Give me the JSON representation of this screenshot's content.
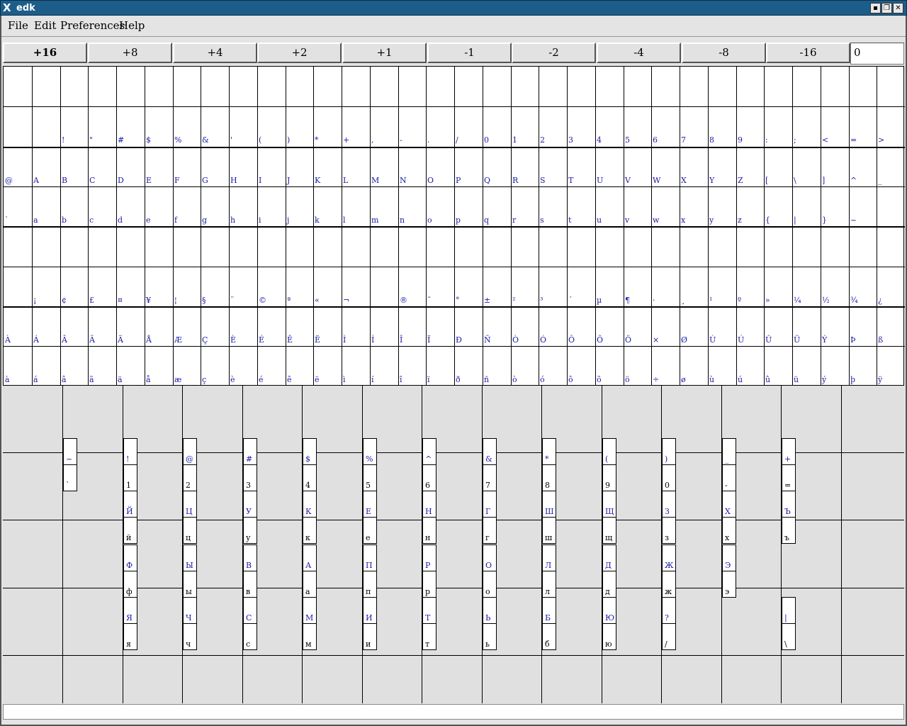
{
  "window": {
    "title": "edk",
    "icon": "x-logo-icon",
    "buttons": [
      "minimize-icon",
      "restore-icon",
      "close-icon"
    ]
  },
  "menu": [
    "File",
    "Edit",
    "Preferences",
    "Help"
  ],
  "steps": [
    "+16",
    "+8",
    "+4",
    "+2",
    "+1",
    "-1",
    "-2",
    "-4",
    "-8",
    "-16"
  ],
  "active_step": "+16",
  "offset_value": "0",
  "char_rows": [
    [
      "",
      "",
      "",
      "",
      "",
      "",
      "",
      "",
      "",
      "",
      "",
      "",
      "",
      "",
      "",
      "",
      "",
      "",
      "",
      "",
      "",
      "",
      "",
      "",
      "",
      "",
      "",
      "",
      "",
      "",
      "",
      ""
    ],
    [
      "",
      " ",
      "!",
      "\"",
      "#",
      "$",
      "%",
      "&",
      "'",
      "(",
      ")",
      "*",
      "+",
      ",",
      "-",
      ".",
      "/",
      "0",
      "1",
      "2",
      "3",
      "4",
      "5",
      "6",
      "7",
      "8",
      "9",
      ":",
      ";",
      "<",
      "=",
      ">",
      "?"
    ],
    [
      "@",
      "A",
      "B",
      "C",
      "D",
      "E",
      "F",
      "G",
      "H",
      "I",
      "J",
      "K",
      "L",
      "M",
      "N",
      "O",
      "P",
      "Q",
      "R",
      "S",
      "T",
      "U",
      "V",
      "W",
      "X",
      "Y",
      "Z",
      "[",
      "\\",
      "]",
      "^",
      "_"
    ],
    [
      "`",
      "a",
      "b",
      "c",
      "d",
      "e",
      "f",
      "g",
      "h",
      "i",
      "j",
      "k",
      "l",
      "m",
      "n",
      "o",
      "p",
      "q",
      "r",
      "s",
      "t",
      "u",
      "v",
      "w",
      "x",
      "y",
      "z",
      "{",
      "|",
      "}",
      "~",
      ""
    ],
    [
      "",
      "",
      "",
      "",
      "",
      "",
      "",
      "",
      "",
      "",
      "",
      "",
      "",
      "",
      "",
      "",
      "",
      "",
      "",
      "",
      "",
      "",
      "",
      "",
      "",
      "",
      "",
      "",
      "",
      "",
      "",
      ""
    ],
    [
      "",
      "¡",
      "¢",
      "£",
      "¤",
      "¥",
      "¦",
      "§",
      "¨",
      "©",
      "ª",
      "«",
      "¬",
      "",
      "®",
      "¯",
      "°",
      "±",
      "²",
      "³",
      "´",
      "µ",
      "¶",
      "·",
      "¸",
      "¹",
      "º",
      "»",
      "¼",
      "½",
      "¾",
      "¿"
    ],
    [
      "À",
      "Á",
      "Â",
      "Ã",
      "Ä",
      "Å",
      "Æ",
      "Ç",
      "È",
      "É",
      "Ê",
      "Ë",
      "Ì",
      "Í",
      "Î",
      "Ï",
      "Ð",
      "Ñ",
      "Ò",
      "Ó",
      "Ô",
      "Õ",
      "Ö",
      "×",
      "Ø",
      "Ù",
      "Ú",
      "Û",
      "Ü",
      "Ý",
      "Þ",
      "ß"
    ],
    [
      "à",
      "á",
      "â",
      "ã",
      "ä",
      "å",
      "æ",
      "ç",
      "è",
      "é",
      "ê",
      "ë",
      "ì",
      "í",
      "î",
      "ï",
      "ð",
      "ñ",
      "ò",
      "ó",
      "ô",
      "õ",
      "ö",
      "÷",
      "ø",
      "ù",
      "ú",
      "û",
      "ü",
      "ý",
      "þ",
      "ÿ"
    ]
  ],
  "keys": [
    {
      "col": 1,
      "row": 0,
      "up": "~",
      "lo": "`"
    },
    {
      "col": 2,
      "row": 0,
      "up": "!",
      "lo": "1"
    },
    {
      "col": 3,
      "row": 0,
      "up": "@",
      "lo": "2"
    },
    {
      "col": 4,
      "row": 0,
      "up": "#",
      "lo": "3"
    },
    {
      "col": 5,
      "row": 0,
      "up": "$",
      "lo": "4"
    },
    {
      "col": 6,
      "row": 0,
      "up": "%",
      "lo": "5"
    },
    {
      "col": 7,
      "row": 0,
      "up": "^",
      "lo": "6"
    },
    {
      "col": 8,
      "row": 0,
      "up": "&",
      "lo": "7"
    },
    {
      "col": 9,
      "row": 0,
      "up": "*",
      "lo": "8"
    },
    {
      "col": 10,
      "row": 0,
      "up": "(",
      "lo": "9"
    },
    {
      "col": 11,
      "row": 0,
      "up": ")",
      "lo": "0"
    },
    {
      "col": 12,
      "row": 0,
      "up": "_",
      "lo": "-"
    },
    {
      "col": 13,
      "row": 0,
      "up": "+",
      "lo": "="
    },
    {
      "col": 2,
      "row": 1,
      "up": "Й",
      "lo": "й"
    },
    {
      "col": 3,
      "row": 1,
      "up": "Ц",
      "lo": "ц"
    },
    {
      "col": 4,
      "row": 1,
      "up": "У",
      "lo": "у"
    },
    {
      "col": 5,
      "row": 1,
      "up": "К",
      "lo": "к"
    },
    {
      "col": 6,
      "row": 1,
      "up": "Е",
      "lo": "е"
    },
    {
      "col": 7,
      "row": 1,
      "up": "Н",
      "lo": "н"
    },
    {
      "col": 8,
      "row": 1,
      "up": "Г",
      "lo": "г"
    },
    {
      "col": 9,
      "row": 1,
      "up": "Ш",
      "lo": "ш"
    },
    {
      "col": 10,
      "row": 1,
      "up": "Щ",
      "lo": "щ"
    },
    {
      "col": 11,
      "row": 1,
      "up": "З",
      "lo": "з"
    },
    {
      "col": 12,
      "row": 1,
      "up": "Х",
      "lo": "х"
    },
    {
      "col": 13,
      "row": 1,
      "up": "Ъ",
      "lo": "ъ"
    },
    {
      "col": 2,
      "row": 2,
      "up": "Ф",
      "lo": "ф"
    },
    {
      "col": 3,
      "row": 2,
      "up": "Ы",
      "lo": "ы"
    },
    {
      "col": 4,
      "row": 2,
      "up": "В",
      "lo": "в"
    },
    {
      "col": 5,
      "row": 2,
      "up": "А",
      "lo": "а"
    },
    {
      "col": 6,
      "row": 2,
      "up": "П",
      "lo": "п"
    },
    {
      "col": 7,
      "row": 2,
      "up": "Р",
      "lo": "р"
    },
    {
      "col": 8,
      "row": 2,
      "up": "О",
      "lo": "о"
    },
    {
      "col": 9,
      "row": 2,
      "up": "Л",
      "lo": "л"
    },
    {
      "col": 10,
      "row": 2,
      "up": "Д",
      "lo": "д"
    },
    {
      "col": 11,
      "row": 2,
      "up": "Ж",
      "lo": "ж"
    },
    {
      "col": 12,
      "row": 2,
      "up": "Э",
      "lo": "э"
    },
    {
      "col": 2,
      "row": 3,
      "up": "Я",
      "lo": "я"
    },
    {
      "col": 3,
      "row": 3,
      "up": "Ч",
      "lo": "ч"
    },
    {
      "col": 4,
      "row": 3,
      "up": "С",
      "lo": "с"
    },
    {
      "col": 5,
      "row": 3,
      "up": "М",
      "lo": "м"
    },
    {
      "col": 6,
      "row": 3,
      "up": "И",
      "lo": "и"
    },
    {
      "col": 7,
      "row": 3,
      "up": "Т",
      "lo": "т"
    },
    {
      "col": 8,
      "row": 3,
      "up": "Ь",
      "lo": "ь"
    },
    {
      "col": 9,
      "row": 3,
      "up": "Б",
      "lo": "б"
    },
    {
      "col": 10,
      "row": 3,
      "up": "Ю",
      "lo": "ю"
    },
    {
      "col": 11,
      "row": 3,
      "up": "?",
      "lo": "/"
    },
    {
      "col": 13,
      "row": 3,
      "up": "|",
      "lo": "\\"
    }
  ],
  "status_text": ""
}
